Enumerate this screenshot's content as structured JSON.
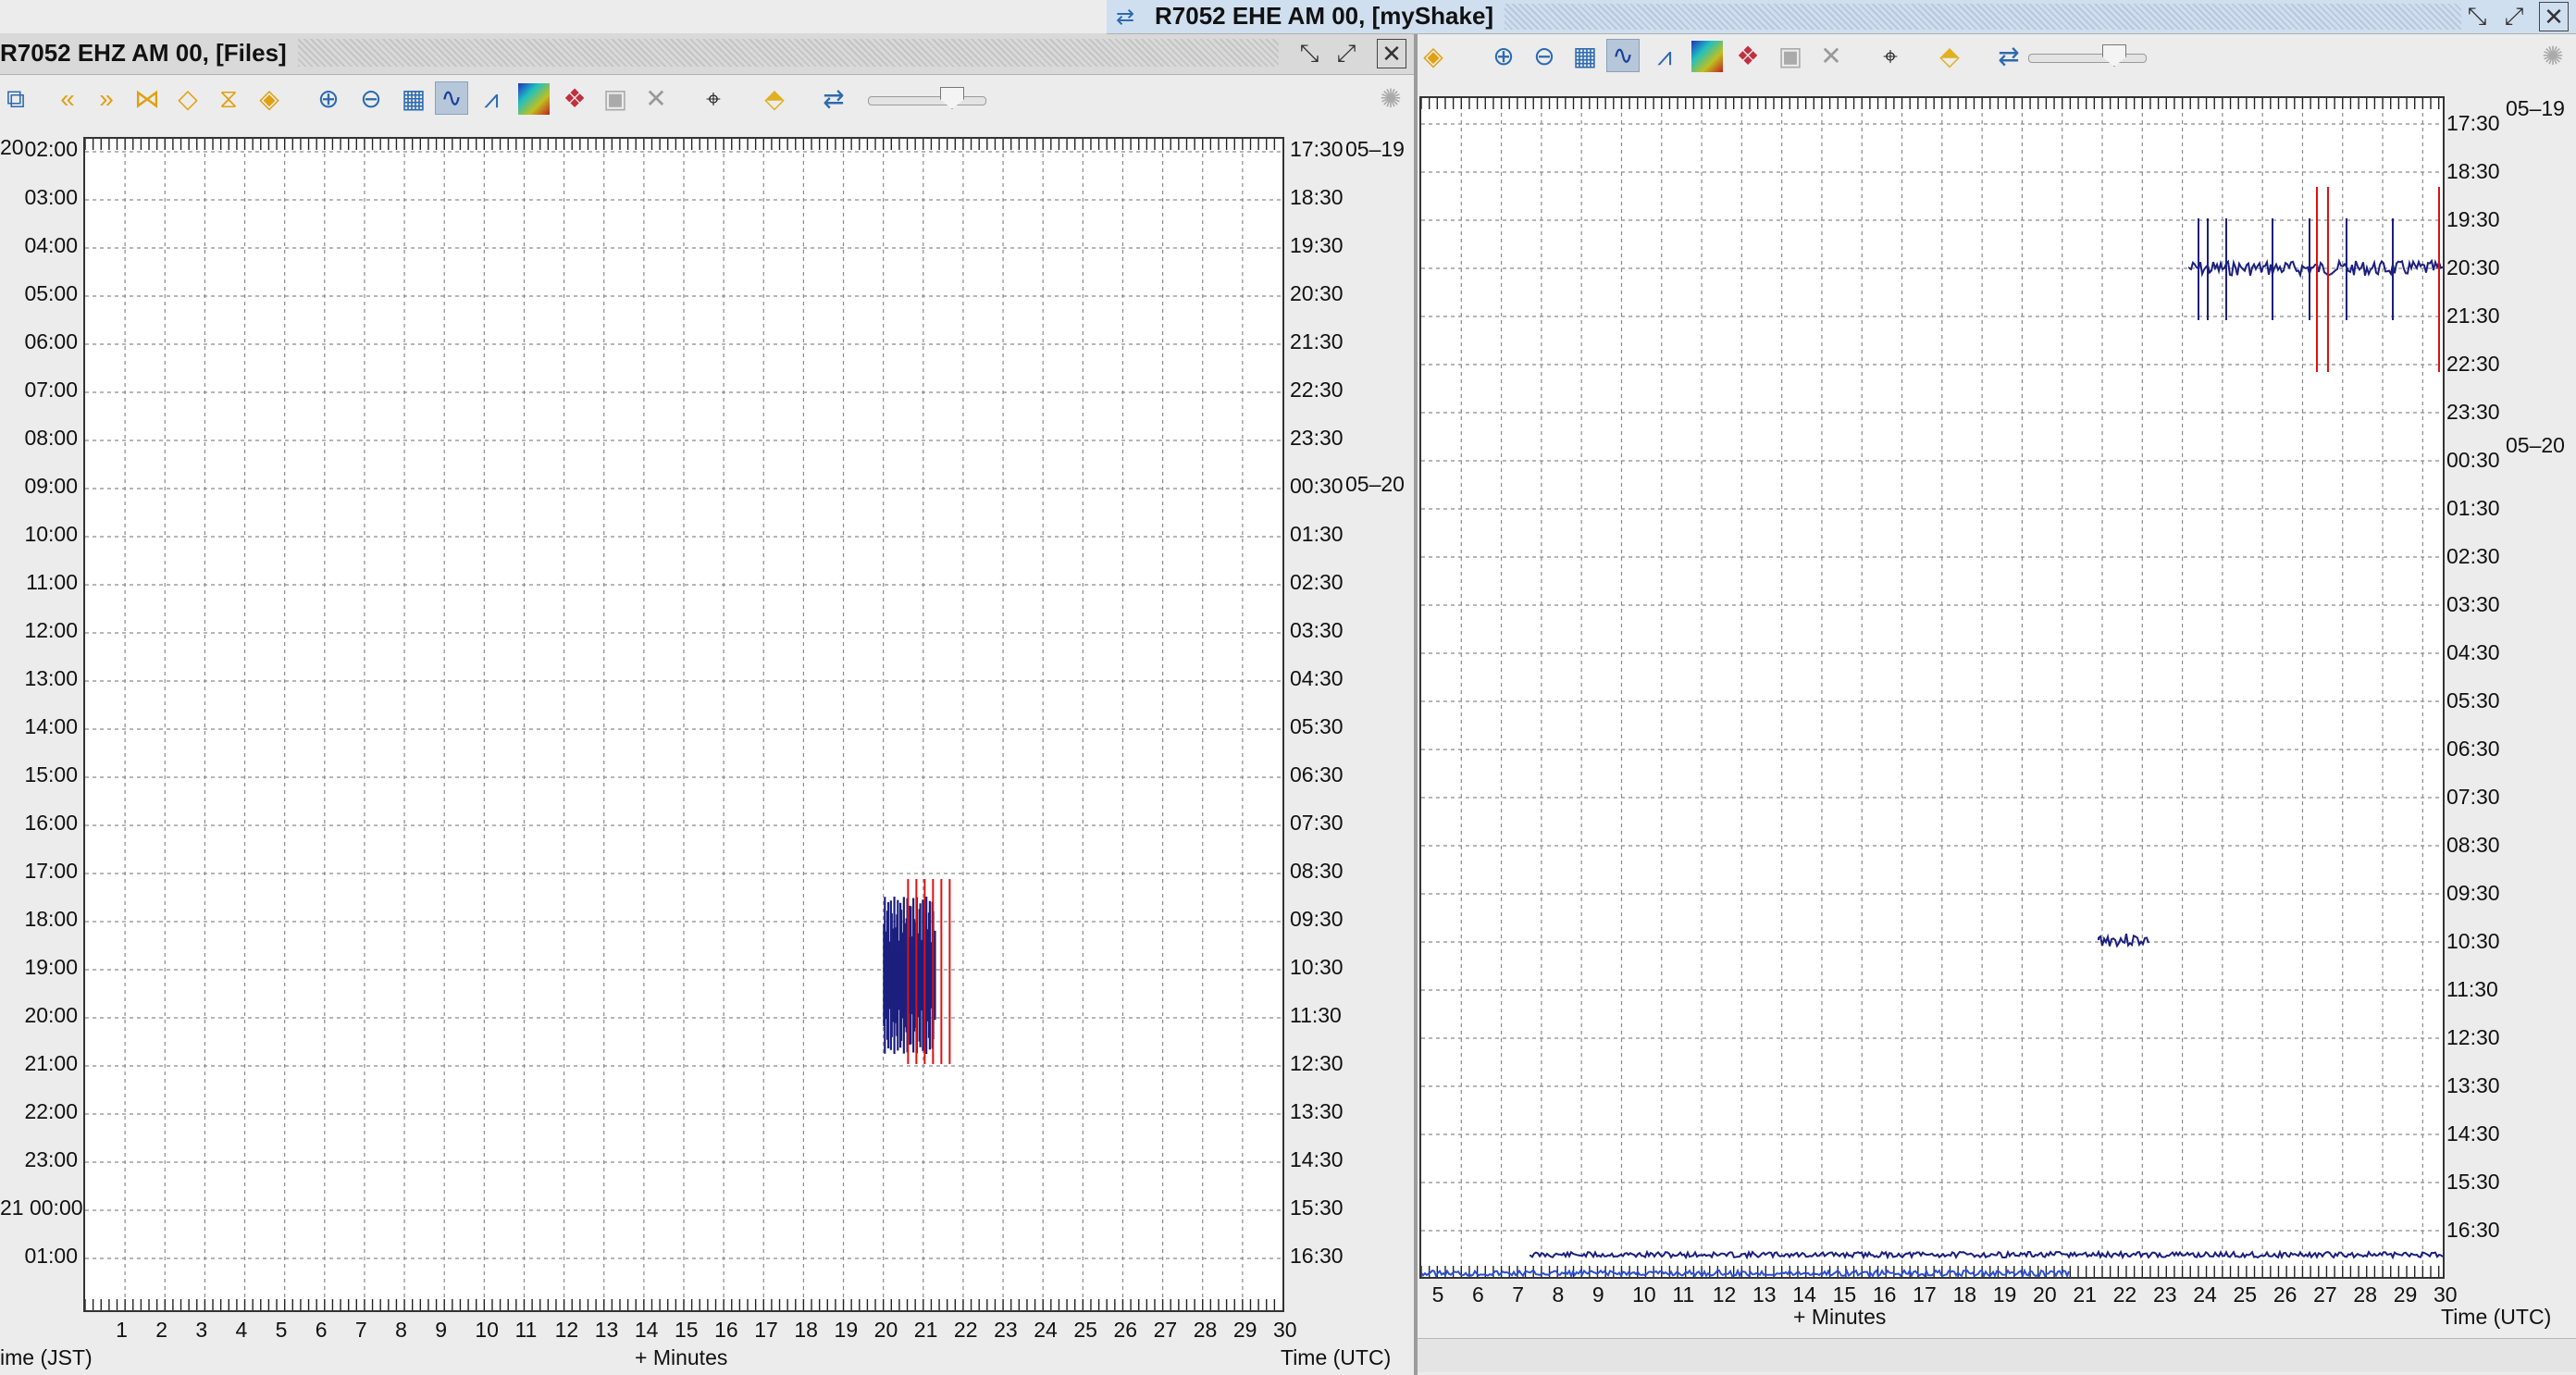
{
  "left_window": {
    "title": "R7052 EHZ AM 00, [Files]",
    "left_tick_labels": [
      "02:00",
      "03:00",
      "04:00",
      "05:00",
      "06:00",
      "07:00",
      "08:00",
      "09:00",
      "10:00",
      "11:00",
      "12:00",
      "13:00",
      "14:00",
      "15:00",
      "16:00",
      "17:00",
      "18:00",
      "19:00",
      "20:00",
      "21:00",
      "22:00",
      "23:00",
      "21 00:00",
      "01:00"
    ],
    "right_tick_labels": [
      "17:30",
      "18:30",
      "19:30",
      "20:30",
      "21:30",
      "22:30",
      "23:30",
      "00:30",
      "01:30",
      "02:30",
      "03:30",
      "04:30",
      "05:30",
      "06:30",
      "07:30",
      "08:30",
      "09:30",
      "10:30",
      "11:30",
      "12:30",
      "13:30",
      "14:30",
      "15:30",
      "16:30"
    ],
    "date_labels": [
      "05–19",
      "05–20"
    ],
    "corner_label": "20",
    "x_ticks": [
      "1",
      "2",
      "3",
      "4",
      "5",
      "6",
      "7",
      "8",
      "9",
      "10",
      "11",
      "12",
      "13",
      "14",
      "15",
      "16",
      "17",
      "18",
      "19",
      "20",
      "21",
      "22",
      "23",
      "24",
      "25",
      "26",
      "27",
      "28",
      "29",
      "30"
    ],
    "x_axis_label": "+ Minutes",
    "left_axis_label": "ime (JST)",
    "right_axis_label": "Time (UTC)"
  },
  "right_window": {
    "title": "R7052 EHE AM 00, [myShake]",
    "right_tick_labels": [
      "17:30",
      "18:30",
      "19:30",
      "20:30",
      "21:30",
      "22:30",
      "23:30",
      "00:30",
      "01:30",
      "02:30",
      "03:30",
      "04:30",
      "05:30",
      "06:30",
      "07:30",
      "08:30",
      "09:30",
      "10:30",
      "11:30",
      "12:30",
      "13:30",
      "14:30",
      "15:30",
      "16:30"
    ],
    "date_labels": [
      "05–19",
      "05–20"
    ],
    "x_ticks": [
      "5",
      "6",
      "7",
      "8",
      "9",
      "10",
      "11",
      "12",
      "13",
      "14",
      "15",
      "16",
      "17",
      "18",
      "19",
      "20",
      "21",
      "22",
      "23",
      "24",
      "25",
      "26",
      "27",
      "28",
      "29",
      "30"
    ],
    "x_axis_label": "+ Minutes",
    "right_axis_label": "Time (UTC)"
  },
  "toolbar_icons": [
    "zoom-in-icon",
    "zoom-out-icon",
    "window-icon",
    "waveform-icon",
    "spectrum-icon",
    "spectrogram-icon",
    "particle-motion-icon",
    "clipboard-icon",
    "close-icon",
    "camera-icon",
    "tag-icon",
    "settings-icon",
    "gain-slider-icon"
  ],
  "colors": {
    "trace": "#1b1f7e",
    "pick": "#e01010",
    "grid": "#8a8a8a",
    "title_right_bg": "#cfdff0"
  }
}
